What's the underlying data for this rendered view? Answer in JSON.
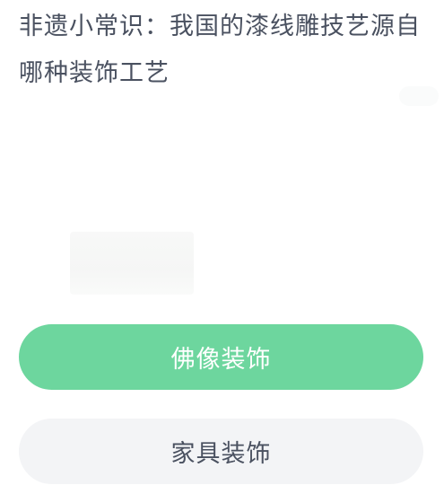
{
  "question": {
    "text": "非遗小常识：我国的漆线雕技艺源自哪种装饰工艺"
  },
  "options": [
    {
      "label": "佛像装饰",
      "selected": true
    },
    {
      "label": "家具装饰",
      "selected": false
    }
  ],
  "colors": {
    "selected_bg": "#6dd69e",
    "selected_text": "#ffffff",
    "option_bg": "#f3f4f6",
    "text": "#4a5160"
  }
}
